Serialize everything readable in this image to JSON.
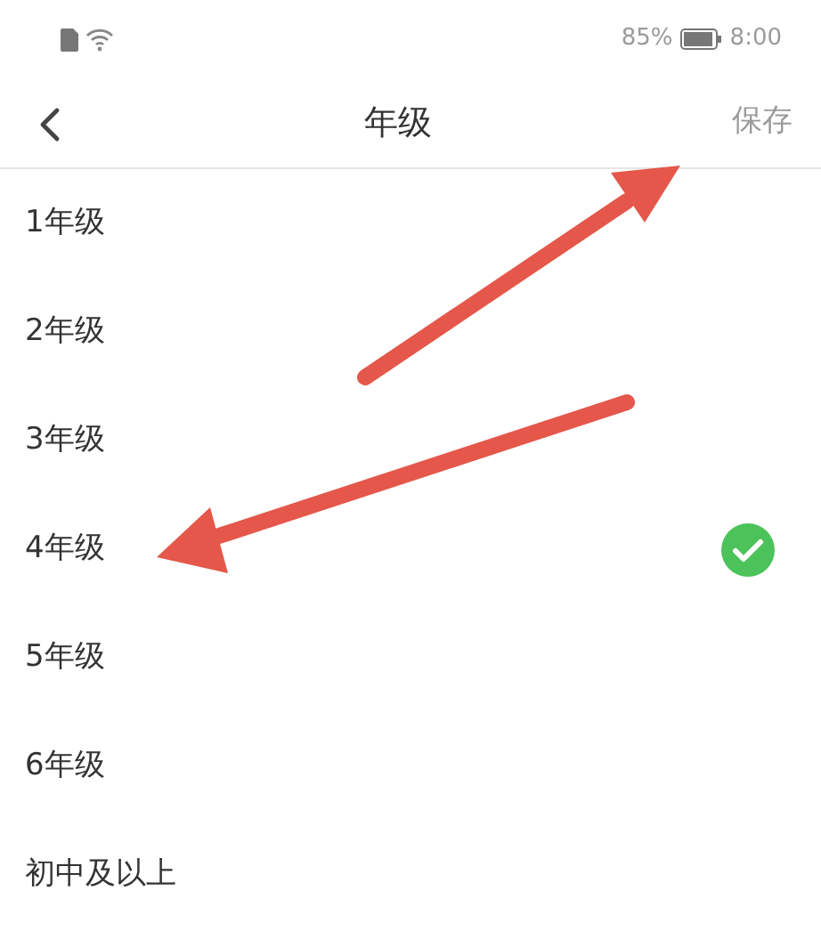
{
  "status_bar": {
    "battery_percent": "85%",
    "time": "8:00"
  },
  "header": {
    "title": "年级",
    "action": "保存"
  },
  "grades": [
    {
      "label": "1年级",
      "selected": false
    },
    {
      "label": "2年级",
      "selected": false
    },
    {
      "label": "3年级",
      "selected": false
    },
    {
      "label": "4年级",
      "selected": true
    },
    {
      "label": "5年级",
      "selected": false
    },
    {
      "label": "6年级",
      "selected": false
    },
    {
      "label": "初中及以上",
      "selected": false
    }
  ]
}
